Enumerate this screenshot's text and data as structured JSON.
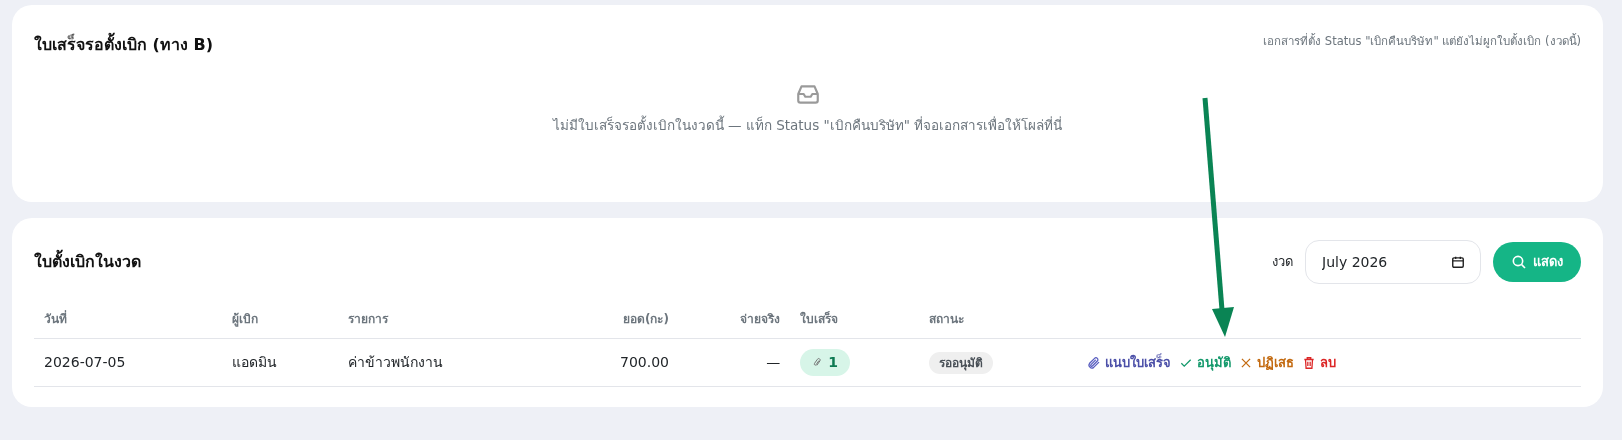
{
  "pending_card": {
    "title": "ใบเสร็จรอตั้งเบิก (ทาง B)",
    "note": "เอกสารที่ตั้ง Status \"เบิกคืนบริษัท\" แต่ยังไม่ผูกใบตั้งเบิก (งวดนี้)",
    "empty_message": "ไม่มีใบเสร็จรอตั้งเบิกในงวดนี้ — แท็ก Status \"เบิกคืนบริษัท\" ที่จอเอกสารเพื่อให้โผล่ที่นี่"
  },
  "claims_card": {
    "title": "ใบตั้งเบิกในงวด",
    "period_label": "งวด",
    "period_value": "July 2026",
    "show_button": "แสดง",
    "table": {
      "columns": [
        "วันที่",
        "ผู้เบิก",
        "รายการ",
        "ยอด(กะ)",
        "จ่ายจริง",
        "ใบเสร็จ",
        "สถานะ"
      ],
      "rows": [
        {
          "date": "2026-07-05",
          "requester": "แอดมิน",
          "item": "ค่าข้าวพนักงาน",
          "amount": "700.00",
          "paid": "—",
          "receipts": "1",
          "status": "รออนุมัติ",
          "actions": [
            {
              "kind": "attach",
              "label": "แนบใบเสร็จ"
            },
            {
              "kind": "approve",
              "label": "อนุมัติ"
            },
            {
              "kind": "reject",
              "label": "ปฏิเสธ"
            },
            {
              "kind": "delete",
              "label": "ลบ"
            }
          ]
        }
      ]
    }
  },
  "annotation": {
    "kind": "arrow"
  }
}
